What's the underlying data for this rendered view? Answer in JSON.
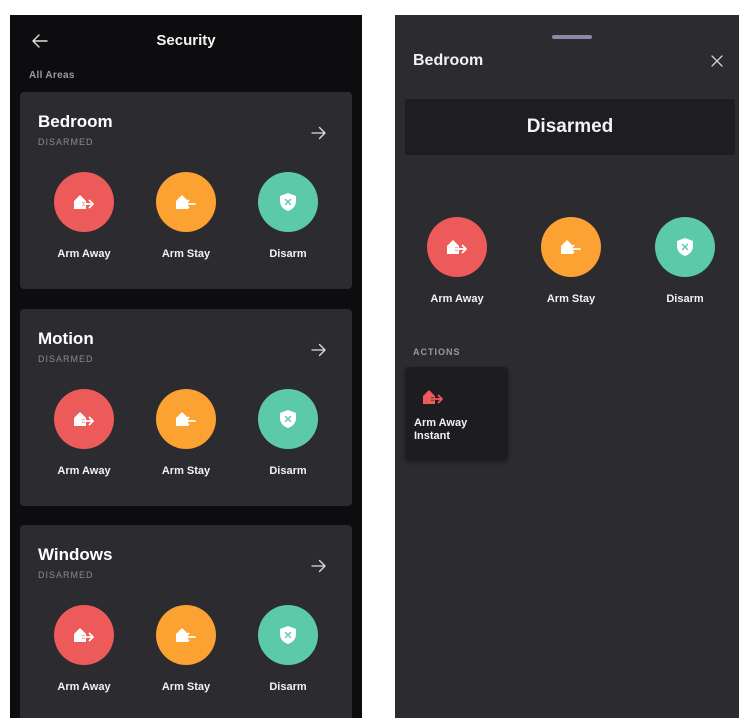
{
  "colors": {
    "arm_away": "#ec5a5a",
    "arm_stay": "#fca232",
    "disarm": "#5ccaa8",
    "card_bg": "#2b2b30",
    "screen_bg": "#0d0d0f"
  },
  "left": {
    "title": "Security",
    "section_label": "All Areas",
    "areas": [
      {
        "name": "Bedroom",
        "status": "DISARMED",
        "buttons": [
          {
            "label": "Arm Away",
            "icon": "arm-away-icon"
          },
          {
            "label": "Arm Stay",
            "icon": "arm-stay-icon"
          },
          {
            "label": "Disarm",
            "icon": "disarm-shield-icon"
          }
        ]
      },
      {
        "name": "Motion",
        "status": "DISARMED",
        "buttons": [
          {
            "label": "Arm Away",
            "icon": "arm-away-icon"
          },
          {
            "label": "Arm Stay",
            "icon": "arm-stay-icon"
          },
          {
            "label": "Disarm",
            "icon": "disarm-shield-icon"
          }
        ]
      },
      {
        "name": "Windows",
        "status": "DISARMED",
        "buttons": [
          {
            "label": "Arm Away",
            "icon": "arm-away-icon"
          },
          {
            "label": "Arm Stay",
            "icon": "arm-stay-icon"
          },
          {
            "label": "Disarm",
            "icon": "disarm-shield-icon"
          }
        ]
      }
    ]
  },
  "right": {
    "title": "Bedroom",
    "state": "Disarmed",
    "buttons": [
      {
        "label": "Arm Away",
        "icon": "arm-away-icon"
      },
      {
        "label": "Arm Stay",
        "icon": "arm-stay-icon"
      },
      {
        "label": "Disarm",
        "icon": "disarm-shield-icon"
      }
    ],
    "actions_label": "ACTIONS",
    "actions": [
      {
        "label": "Arm Away Instant",
        "icon": "arm-away-instant-icon"
      }
    ]
  }
}
